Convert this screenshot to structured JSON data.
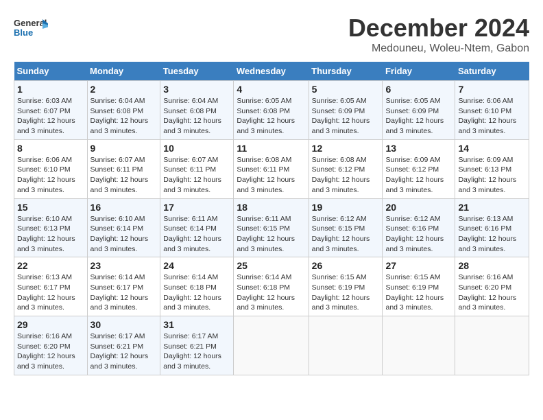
{
  "header": {
    "logo_general": "General",
    "logo_blue": "Blue",
    "title": "December 2024",
    "subtitle": "Medouneu, Woleu-Ntem, Gabon"
  },
  "calendar": {
    "weekdays": [
      "Sunday",
      "Monday",
      "Tuesday",
      "Wednesday",
      "Thursday",
      "Friday",
      "Saturday"
    ],
    "weeks": [
      [
        {
          "day": "1",
          "sunrise": "6:03 AM",
          "sunset": "6:07 PM",
          "daylight": "12 hours and 3 minutes."
        },
        {
          "day": "2",
          "sunrise": "6:04 AM",
          "sunset": "6:08 PM",
          "daylight": "12 hours and 3 minutes."
        },
        {
          "day": "3",
          "sunrise": "6:04 AM",
          "sunset": "6:08 PM",
          "daylight": "12 hours and 3 minutes."
        },
        {
          "day": "4",
          "sunrise": "6:05 AM",
          "sunset": "6:08 PM",
          "daylight": "12 hours and 3 minutes."
        },
        {
          "day": "5",
          "sunrise": "6:05 AM",
          "sunset": "6:09 PM",
          "daylight": "12 hours and 3 minutes."
        },
        {
          "day": "6",
          "sunrise": "6:05 AM",
          "sunset": "6:09 PM",
          "daylight": "12 hours and 3 minutes."
        },
        {
          "day": "7",
          "sunrise": "6:06 AM",
          "sunset": "6:10 PM",
          "daylight": "12 hours and 3 minutes."
        }
      ],
      [
        {
          "day": "8",
          "sunrise": "6:06 AM",
          "sunset": "6:10 PM",
          "daylight": "12 hours and 3 minutes."
        },
        {
          "day": "9",
          "sunrise": "6:07 AM",
          "sunset": "6:11 PM",
          "daylight": "12 hours and 3 minutes."
        },
        {
          "day": "10",
          "sunrise": "6:07 AM",
          "sunset": "6:11 PM",
          "daylight": "12 hours and 3 minutes."
        },
        {
          "day": "11",
          "sunrise": "6:08 AM",
          "sunset": "6:11 PM",
          "daylight": "12 hours and 3 minutes."
        },
        {
          "day": "12",
          "sunrise": "6:08 AM",
          "sunset": "6:12 PM",
          "daylight": "12 hours and 3 minutes."
        },
        {
          "day": "13",
          "sunrise": "6:09 AM",
          "sunset": "6:12 PM",
          "daylight": "12 hours and 3 minutes."
        },
        {
          "day": "14",
          "sunrise": "6:09 AM",
          "sunset": "6:13 PM",
          "daylight": "12 hours and 3 minutes."
        }
      ],
      [
        {
          "day": "15",
          "sunrise": "6:10 AM",
          "sunset": "6:13 PM",
          "daylight": "12 hours and 3 minutes."
        },
        {
          "day": "16",
          "sunrise": "6:10 AM",
          "sunset": "6:14 PM",
          "daylight": "12 hours and 3 minutes."
        },
        {
          "day": "17",
          "sunrise": "6:11 AM",
          "sunset": "6:14 PM",
          "daylight": "12 hours and 3 minutes."
        },
        {
          "day": "18",
          "sunrise": "6:11 AM",
          "sunset": "6:15 PM",
          "daylight": "12 hours and 3 minutes."
        },
        {
          "day": "19",
          "sunrise": "6:12 AM",
          "sunset": "6:15 PM",
          "daylight": "12 hours and 3 minutes."
        },
        {
          "day": "20",
          "sunrise": "6:12 AM",
          "sunset": "6:16 PM",
          "daylight": "12 hours and 3 minutes."
        },
        {
          "day": "21",
          "sunrise": "6:13 AM",
          "sunset": "6:16 PM",
          "daylight": "12 hours and 3 minutes."
        }
      ],
      [
        {
          "day": "22",
          "sunrise": "6:13 AM",
          "sunset": "6:17 PM",
          "daylight": "12 hours and 3 minutes."
        },
        {
          "day": "23",
          "sunrise": "6:14 AM",
          "sunset": "6:17 PM",
          "daylight": "12 hours and 3 minutes."
        },
        {
          "day": "24",
          "sunrise": "6:14 AM",
          "sunset": "6:18 PM",
          "daylight": "12 hours and 3 minutes."
        },
        {
          "day": "25",
          "sunrise": "6:14 AM",
          "sunset": "6:18 PM",
          "daylight": "12 hours and 3 minutes."
        },
        {
          "day": "26",
          "sunrise": "6:15 AM",
          "sunset": "6:19 PM",
          "daylight": "12 hours and 3 minutes."
        },
        {
          "day": "27",
          "sunrise": "6:15 AM",
          "sunset": "6:19 PM",
          "daylight": "12 hours and 3 minutes."
        },
        {
          "day": "28",
          "sunrise": "6:16 AM",
          "sunset": "6:20 PM",
          "daylight": "12 hours and 3 minutes."
        }
      ],
      [
        {
          "day": "29",
          "sunrise": "6:16 AM",
          "sunset": "6:20 PM",
          "daylight": "12 hours and 3 minutes."
        },
        {
          "day": "30",
          "sunrise": "6:17 AM",
          "sunset": "6:21 PM",
          "daylight": "12 hours and 3 minutes."
        },
        {
          "day": "31",
          "sunrise": "6:17 AM",
          "sunset": "6:21 PM",
          "daylight": "12 hours and 3 minutes."
        },
        null,
        null,
        null,
        null
      ]
    ]
  }
}
